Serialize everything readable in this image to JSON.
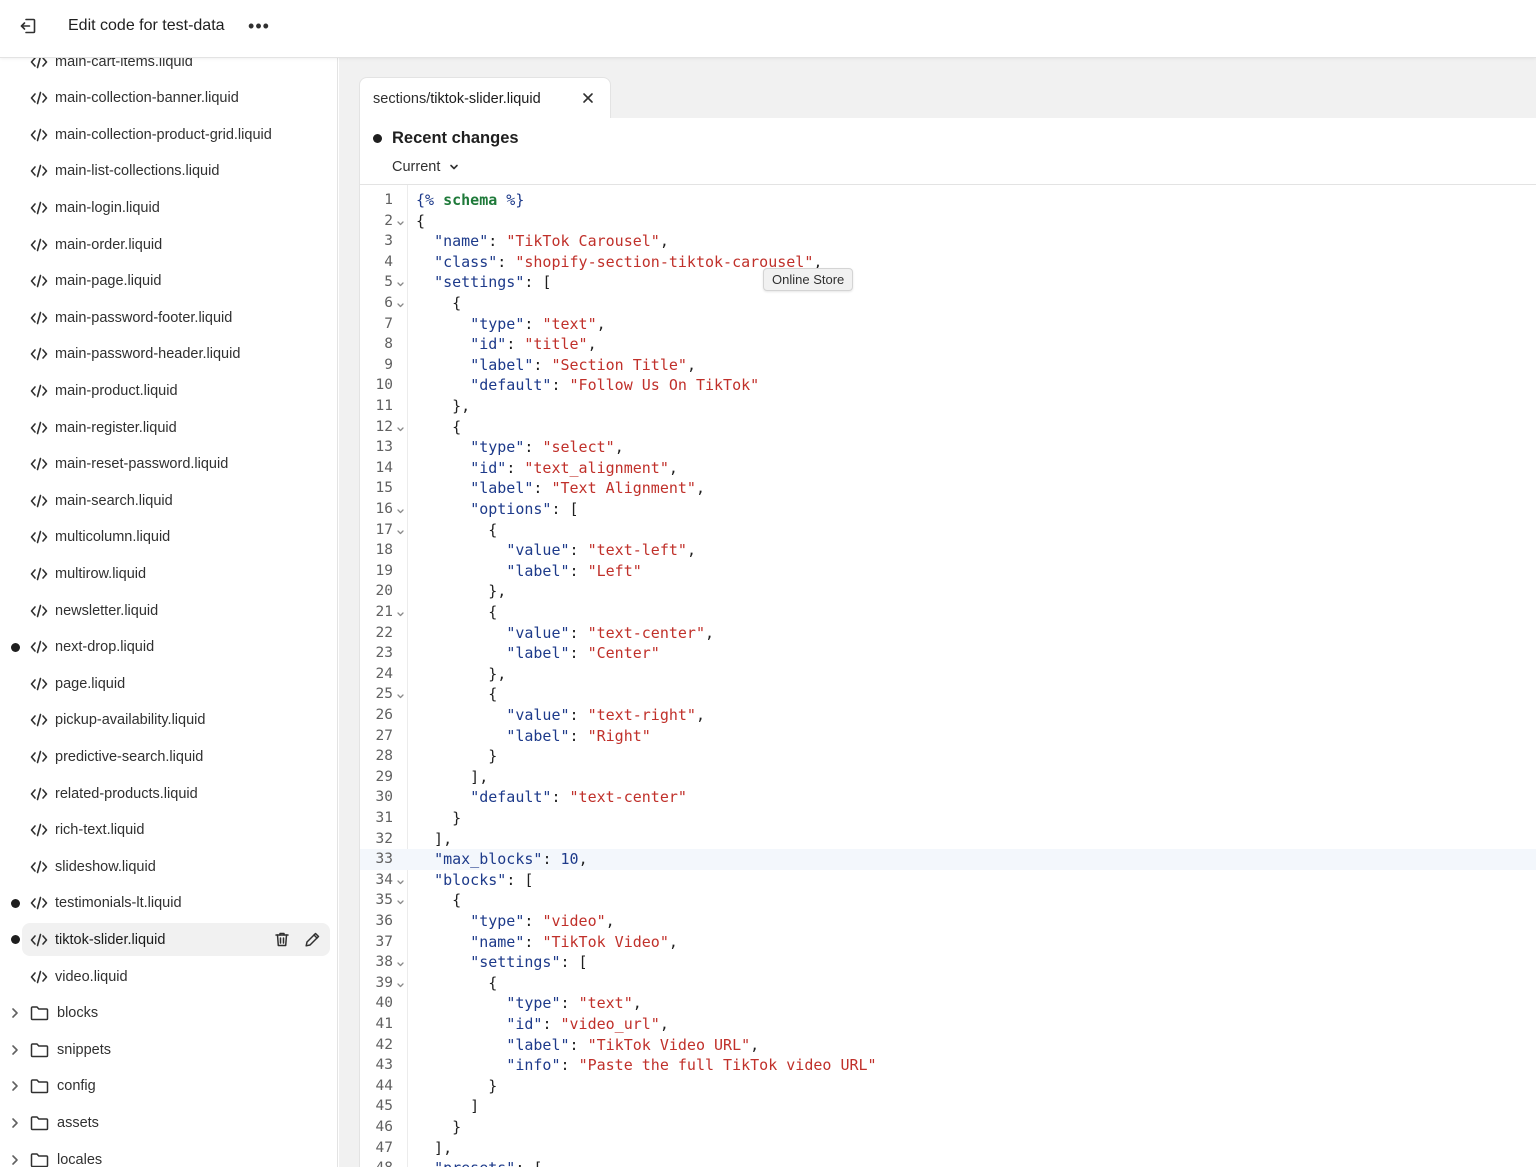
{
  "header": {
    "title": "Edit code for test-data",
    "more_label": "•••"
  },
  "sidebar": {
    "files": [
      {
        "name": "main-cart-items.liquid",
        "modified": false
      },
      {
        "name": "main-collection-banner.liquid",
        "modified": false
      },
      {
        "name": "main-collection-product-grid.liquid",
        "modified": false
      },
      {
        "name": "main-list-collections.liquid",
        "modified": false
      },
      {
        "name": "main-login.liquid",
        "modified": false
      },
      {
        "name": "main-order.liquid",
        "modified": false
      },
      {
        "name": "main-page.liquid",
        "modified": false
      },
      {
        "name": "main-password-footer.liquid",
        "modified": false
      },
      {
        "name": "main-password-header.liquid",
        "modified": false
      },
      {
        "name": "main-product.liquid",
        "modified": false
      },
      {
        "name": "main-register.liquid",
        "modified": false
      },
      {
        "name": "main-reset-password.liquid",
        "modified": false
      },
      {
        "name": "main-search.liquid",
        "modified": false
      },
      {
        "name": "multicolumn.liquid",
        "modified": false
      },
      {
        "name": "multirow.liquid",
        "modified": false
      },
      {
        "name": "newsletter.liquid",
        "modified": false
      },
      {
        "name": "next-drop.liquid",
        "modified": true
      },
      {
        "name": "page.liquid",
        "modified": false
      },
      {
        "name": "pickup-availability.liquid",
        "modified": false
      },
      {
        "name": "predictive-search.liquid",
        "modified": false
      },
      {
        "name": "related-products.liquid",
        "modified": false
      },
      {
        "name": "rich-text.liquid",
        "modified": false
      },
      {
        "name": "slideshow.liquid",
        "modified": false
      },
      {
        "name": "testimonials-lt.liquid",
        "modified": true
      },
      {
        "name": "tiktok-slider.liquid",
        "modified": true,
        "selected": true
      },
      {
        "name": "video.liquid",
        "modified": false
      }
    ],
    "folders": [
      {
        "name": "blocks"
      },
      {
        "name": "snippets"
      },
      {
        "name": "config"
      },
      {
        "name": "assets"
      },
      {
        "name": "locales"
      }
    ]
  },
  "tab": {
    "path": "sections/",
    "file": "tiktok-slider.liquid"
  },
  "recent_changes": {
    "label": "Recent changes",
    "version": "Current"
  },
  "tooltip": "Online Store",
  "code_lines": [
    {
      "n": "1",
      "fold": false,
      "tokens": [
        [
          "tag",
          "{% "
        ],
        [
          "kw",
          "schema"
        ],
        [
          "tag",
          " %}"
        ]
      ]
    },
    {
      "n": "2",
      "fold": true,
      "tokens": [
        [
          "p",
          "{"
        ]
      ]
    },
    {
      "n": "3",
      "fold": false,
      "tokens": [
        [
          "p",
          "  "
        ],
        [
          "key",
          "\"name\""
        ],
        [
          "p",
          ": "
        ],
        [
          "str",
          "\"TikTok Carousel\""
        ],
        [
          "p",
          ","
        ]
      ]
    },
    {
      "n": "4",
      "fold": false,
      "tokens": [
        [
          "p",
          "  "
        ],
        [
          "key",
          "\"class\""
        ],
        [
          "p",
          ": "
        ],
        [
          "str",
          "\"shopify-section-tiktok-carousel\""
        ],
        [
          "p",
          ","
        ]
      ]
    },
    {
      "n": "5",
      "fold": true,
      "tokens": [
        [
          "p",
          "  "
        ],
        [
          "key",
          "\"settings\""
        ],
        [
          "p",
          ": ["
        ]
      ]
    },
    {
      "n": "6",
      "fold": true,
      "tokens": [
        [
          "p",
          "    {"
        ]
      ]
    },
    {
      "n": "7",
      "fold": false,
      "tokens": [
        [
          "p",
          "      "
        ],
        [
          "key",
          "\"type\""
        ],
        [
          "p",
          ": "
        ],
        [
          "str",
          "\"text\""
        ],
        [
          "p",
          ","
        ]
      ]
    },
    {
      "n": "8",
      "fold": false,
      "tokens": [
        [
          "p",
          "      "
        ],
        [
          "key",
          "\"id\""
        ],
        [
          "p",
          ": "
        ],
        [
          "str",
          "\"title\""
        ],
        [
          "p",
          ","
        ]
      ]
    },
    {
      "n": "9",
      "fold": false,
      "tokens": [
        [
          "p",
          "      "
        ],
        [
          "key",
          "\"label\""
        ],
        [
          "p",
          ": "
        ],
        [
          "str",
          "\"Section Title\""
        ],
        [
          "p",
          ","
        ]
      ]
    },
    {
      "n": "10",
      "fold": false,
      "tokens": [
        [
          "p",
          "      "
        ],
        [
          "key",
          "\"default\""
        ],
        [
          "p",
          ": "
        ],
        [
          "str",
          "\"Follow Us On TikTok\""
        ]
      ]
    },
    {
      "n": "11",
      "fold": false,
      "tokens": [
        [
          "p",
          "    },"
        ]
      ]
    },
    {
      "n": "12",
      "fold": true,
      "tokens": [
        [
          "p",
          "    {"
        ]
      ]
    },
    {
      "n": "13",
      "fold": false,
      "tokens": [
        [
          "p",
          "      "
        ],
        [
          "key",
          "\"type\""
        ],
        [
          "p",
          ": "
        ],
        [
          "str",
          "\"select\""
        ],
        [
          "p",
          ","
        ]
      ]
    },
    {
      "n": "14",
      "fold": false,
      "tokens": [
        [
          "p",
          "      "
        ],
        [
          "key",
          "\"id\""
        ],
        [
          "p",
          ": "
        ],
        [
          "str",
          "\"text_alignment\""
        ],
        [
          "p",
          ","
        ]
      ]
    },
    {
      "n": "15",
      "fold": false,
      "tokens": [
        [
          "p",
          "      "
        ],
        [
          "key",
          "\"label\""
        ],
        [
          "p",
          ": "
        ],
        [
          "str",
          "\"Text Alignment\""
        ],
        [
          "p",
          ","
        ]
      ]
    },
    {
      "n": "16",
      "fold": true,
      "tokens": [
        [
          "p",
          "      "
        ],
        [
          "key",
          "\"options\""
        ],
        [
          "p",
          ": ["
        ]
      ]
    },
    {
      "n": "17",
      "fold": true,
      "tokens": [
        [
          "p",
          "        {"
        ]
      ]
    },
    {
      "n": "18",
      "fold": false,
      "tokens": [
        [
          "p",
          "          "
        ],
        [
          "key",
          "\"value\""
        ],
        [
          "p",
          ": "
        ],
        [
          "str",
          "\"text-left\""
        ],
        [
          "p",
          ","
        ]
      ]
    },
    {
      "n": "19",
      "fold": false,
      "tokens": [
        [
          "p",
          "          "
        ],
        [
          "key",
          "\"label\""
        ],
        [
          "p",
          ": "
        ],
        [
          "str",
          "\"Left\""
        ]
      ]
    },
    {
      "n": "20",
      "fold": false,
      "tokens": [
        [
          "p",
          "        },"
        ]
      ]
    },
    {
      "n": "21",
      "fold": true,
      "tokens": [
        [
          "p",
          "        {"
        ]
      ]
    },
    {
      "n": "22",
      "fold": false,
      "tokens": [
        [
          "p",
          "          "
        ],
        [
          "key",
          "\"value\""
        ],
        [
          "p",
          ": "
        ],
        [
          "str",
          "\"text-center\""
        ],
        [
          "p",
          ","
        ]
      ]
    },
    {
      "n": "23",
      "fold": false,
      "tokens": [
        [
          "p",
          "          "
        ],
        [
          "key",
          "\"label\""
        ],
        [
          "p",
          ": "
        ],
        [
          "str",
          "\"Center\""
        ]
      ]
    },
    {
      "n": "24",
      "fold": false,
      "tokens": [
        [
          "p",
          "        },"
        ]
      ]
    },
    {
      "n": "25",
      "fold": true,
      "tokens": [
        [
          "p",
          "        {"
        ]
      ]
    },
    {
      "n": "26",
      "fold": false,
      "tokens": [
        [
          "p",
          "          "
        ],
        [
          "key",
          "\"value\""
        ],
        [
          "p",
          ": "
        ],
        [
          "str",
          "\"text-right\""
        ],
        [
          "p",
          ","
        ]
      ]
    },
    {
      "n": "27",
      "fold": false,
      "tokens": [
        [
          "p",
          "          "
        ],
        [
          "key",
          "\"label\""
        ],
        [
          "p",
          ": "
        ],
        [
          "str",
          "\"Right\""
        ]
      ]
    },
    {
      "n": "28",
      "fold": false,
      "tokens": [
        [
          "p",
          "        }"
        ]
      ]
    },
    {
      "n": "29",
      "fold": false,
      "tokens": [
        [
          "p",
          "      ],"
        ]
      ]
    },
    {
      "n": "30",
      "fold": false,
      "tokens": [
        [
          "p",
          "      "
        ],
        [
          "key",
          "\"default\""
        ],
        [
          "p",
          ": "
        ],
        [
          "str",
          "\"text-center\""
        ]
      ]
    },
    {
      "n": "31",
      "fold": false,
      "tokens": [
        [
          "p",
          "    }"
        ]
      ]
    },
    {
      "n": "32",
      "fold": false,
      "tokens": [
        [
          "p",
          "  ],"
        ]
      ]
    },
    {
      "n": "33",
      "fold": false,
      "active": true,
      "tokens": [
        [
          "p",
          "  "
        ],
        [
          "key",
          "\"max_blocks\""
        ],
        [
          "p",
          ": "
        ],
        [
          "num",
          "10"
        ],
        [
          "p",
          ","
        ]
      ]
    },
    {
      "n": "34",
      "fold": true,
      "tokens": [
        [
          "p",
          "  "
        ],
        [
          "key",
          "\"blocks\""
        ],
        [
          "p",
          ": ["
        ]
      ]
    },
    {
      "n": "35",
      "fold": true,
      "tokens": [
        [
          "p",
          "    {"
        ]
      ]
    },
    {
      "n": "36",
      "fold": false,
      "tokens": [
        [
          "p",
          "      "
        ],
        [
          "key",
          "\"type\""
        ],
        [
          "p",
          ": "
        ],
        [
          "str",
          "\"video\""
        ],
        [
          "p",
          ","
        ]
      ]
    },
    {
      "n": "37",
      "fold": false,
      "tokens": [
        [
          "p",
          "      "
        ],
        [
          "key",
          "\"name\""
        ],
        [
          "p",
          ": "
        ],
        [
          "str",
          "\"TikTok Video\""
        ],
        [
          "p",
          ","
        ]
      ]
    },
    {
      "n": "38",
      "fold": true,
      "tokens": [
        [
          "p",
          "      "
        ],
        [
          "key",
          "\"settings\""
        ],
        [
          "p",
          ": ["
        ]
      ]
    },
    {
      "n": "39",
      "fold": true,
      "tokens": [
        [
          "p",
          "        {"
        ]
      ]
    },
    {
      "n": "40",
      "fold": false,
      "tokens": [
        [
          "p",
          "          "
        ],
        [
          "key",
          "\"type\""
        ],
        [
          "p",
          ": "
        ],
        [
          "str",
          "\"text\""
        ],
        [
          "p",
          ","
        ]
      ]
    },
    {
      "n": "41",
      "fold": false,
      "tokens": [
        [
          "p",
          "          "
        ],
        [
          "key",
          "\"id\""
        ],
        [
          "p",
          ": "
        ],
        [
          "str",
          "\"video_url\""
        ],
        [
          "p",
          ","
        ]
      ]
    },
    {
      "n": "42",
      "fold": false,
      "tokens": [
        [
          "p",
          "          "
        ],
        [
          "key",
          "\"label\""
        ],
        [
          "p",
          ": "
        ],
        [
          "str",
          "\"TikTok Video URL\""
        ],
        [
          "p",
          ","
        ]
      ]
    },
    {
      "n": "43",
      "fold": false,
      "tokens": [
        [
          "p",
          "          "
        ],
        [
          "key",
          "\"info\""
        ],
        [
          "p",
          ": "
        ],
        [
          "str",
          "\"Paste the full TikTok video URL\""
        ]
      ]
    },
    {
      "n": "44",
      "fold": false,
      "tokens": [
        [
          "p",
          "        }"
        ]
      ]
    },
    {
      "n": "45",
      "fold": false,
      "tokens": [
        [
          "p",
          "      ]"
        ]
      ]
    },
    {
      "n": "46",
      "fold": false,
      "tokens": [
        [
          "p",
          "    }"
        ]
      ]
    },
    {
      "n": "47",
      "fold": false,
      "tokens": [
        [
          "p",
          "  ],"
        ]
      ]
    },
    {
      "n": "48",
      "fold": true,
      "tokens": [
        [
          "p",
          "  "
        ],
        [
          "key",
          "\"presets\""
        ],
        [
          "p",
          ": ["
        ]
      ]
    }
  ],
  "colors": {
    "key": "#1d3a8a",
    "string": "#c0302a",
    "keyword": "#1f7a3a"
  }
}
